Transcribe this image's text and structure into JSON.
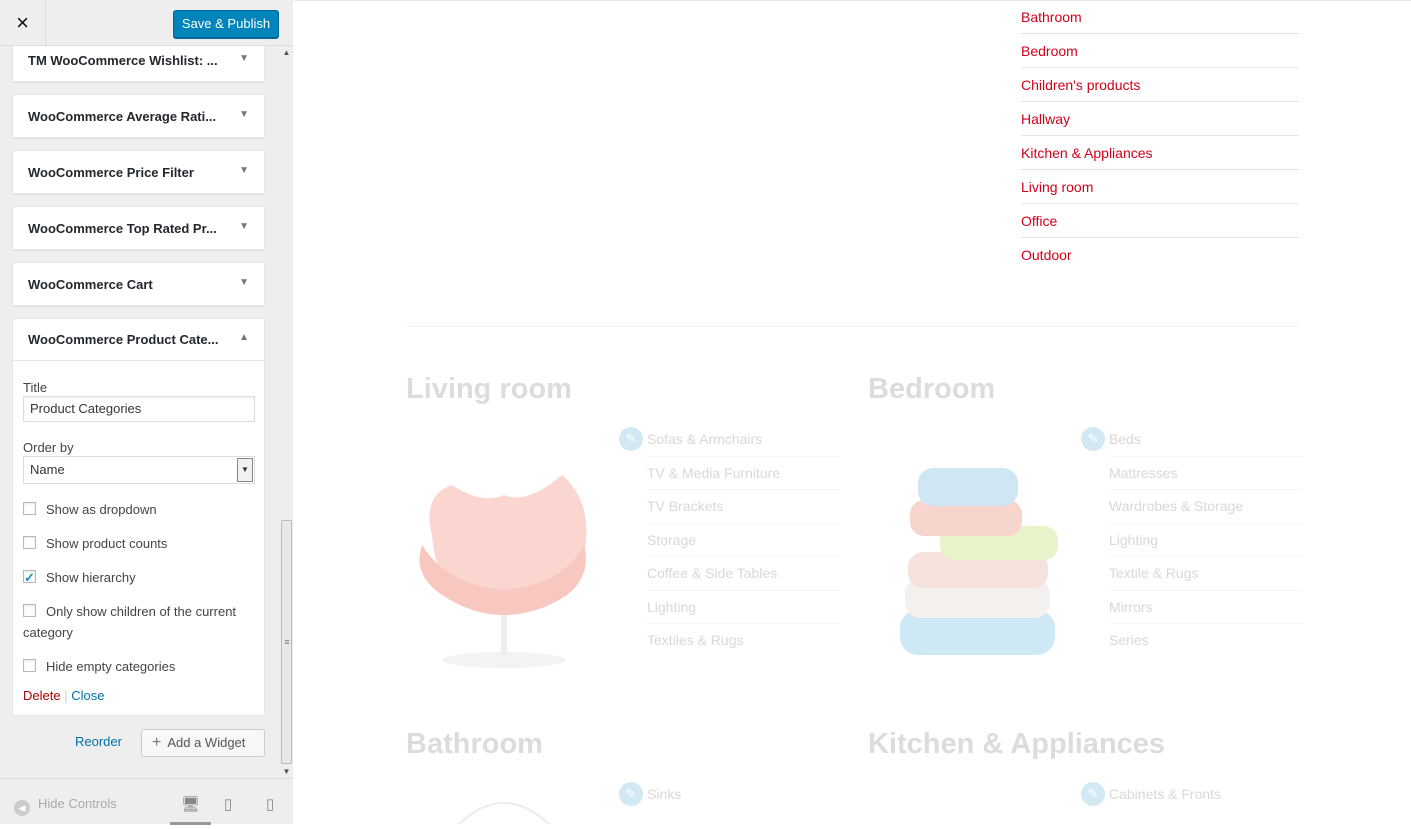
{
  "topbar": {
    "close_icon": "×",
    "save_label": "Save & Publish"
  },
  "widgets": [
    {
      "title": "TM WooCommerce Wishlist: ..."
    },
    {
      "title": "WooCommerce Average Rati..."
    },
    {
      "title": "WooCommerce Price Filter"
    },
    {
      "title": "WooCommerce Top Rated Pr..."
    },
    {
      "title": "WooCommerce Cart"
    }
  ],
  "open_widget": {
    "title": "WooCommerce Product Cate...",
    "title_label": "Title",
    "title_value": "Product Categories",
    "order_label": "Order by",
    "order_value": "Name",
    "checkboxes": [
      {
        "label": "Show as dropdown",
        "checked": false
      },
      {
        "label": "Show product counts",
        "checked": false
      },
      {
        "label": "Show hierarchy",
        "checked": true
      },
      {
        "label": "Only show children of the current category",
        "checked": false
      },
      {
        "label": "Hide empty categories",
        "checked": false
      }
    ],
    "delete_label": "Delete",
    "separator": "|",
    "close_label": "Close"
  },
  "bottom": {
    "reorder_label": "Reorder",
    "add_widget_label": "Add a Widget",
    "add_widget_icon": "+"
  },
  "footer": {
    "hide_controls_label": "Hide Controls",
    "hide_controls_icon": "◀"
  },
  "preview": {
    "category_links": [
      "Bathroom",
      "Bedroom",
      "Children's products",
      "Hallway",
      "Kitchen & Appliances",
      "Living room",
      "Office",
      "Outdoor"
    ],
    "sections": [
      {
        "title": "Living room",
        "items": [
          "Sofas & Armchairs",
          "TV & Media Furniture",
          "TV Brackets",
          "Storage",
          "Coffee & Side Tables",
          "Lighting",
          "Textiles & Rugs"
        ]
      },
      {
        "title": "Bedroom",
        "items": [
          "Beds",
          "Mattresses",
          "Wardrobes & Storage",
          "Lighting",
          "Textile & Rugs",
          "Mirrors",
          "Series"
        ]
      },
      {
        "title": "Bathroom",
        "items": [
          "Sinks"
        ]
      },
      {
        "title": "Kitchen & Appliances",
        "items": [
          "Cabinets & Fronts"
        ]
      }
    ]
  },
  "colors": {
    "accent": "#0085ba",
    "link_red": "#d0021b",
    "link_blue": "#0073aa",
    "delete_red": "#a00"
  }
}
